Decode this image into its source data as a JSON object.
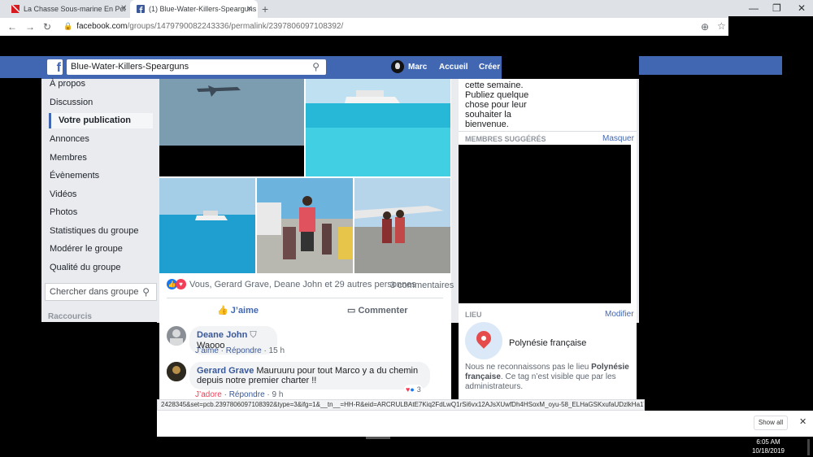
{
  "browser": {
    "tabs": [
      {
        "title": "La Chasse Sous-marine En Pol"
      },
      {
        "title": "(1) Blue-Water-Killers-Spearguns"
      }
    ],
    "url_host": "facebook.com",
    "url_path": "/groups/1479790082243336/permalink/2397806097108392/",
    "new_tab_glyph": "+",
    "status_url": "2428345&set=pcb.2397806097108392&type=3&ifg=1&__tn__=HH-R&eid=ARCRULBAtE7Kiq2FdLwQ1rSi6vx12AJsXUwfDh4HSoxM_oyu-58_ELHaGSKxufaUDzlkHa1V0AxftYfK"
  },
  "fb_header": {
    "group_search_value": "Blue-Water-Killers-Spearguns",
    "user_name": "Marc",
    "nav": [
      "Accueil",
      "Créer"
    ]
  },
  "left_nav": {
    "items": [
      "À propos",
      "Discussion",
      "Votre publication",
      "Annonces",
      "Membres",
      "Évènements",
      "Vidéos",
      "Photos",
      "Statistiques du groupe",
      "Modérer le groupe",
      "Qualité du groupe"
    ],
    "active_index": 2,
    "search_placeholder": "Chercher dans groupe",
    "shortcuts_heading": "Raccourcis"
  },
  "post": {
    "reactions_text": "Vous, Gerard Grave, Deane John et 29 autres personnes",
    "comments_count": "3 commentaires",
    "like_label": "J’aime",
    "comment_label": "Commenter",
    "comments": [
      {
        "author": "Deane John",
        "text": "Waooo",
        "actions": [
          "J’aime",
          "Répondre",
          "15 h"
        ]
      },
      {
        "author": "Gerard Grave",
        "text": "Mauruuru pour tout Marco y a du chemin depuis notre premier charter !!",
        "actions": [
          "J’adore",
          "Répondre",
          "9 h"
        ],
        "reaction_count": "3"
      }
    ]
  },
  "right_col": {
    "welcome_lines": [
      "cette semaine.",
      "Publiez quelque",
      "chose pour leur",
      "souhaiter la",
      "bienvenue."
    ],
    "suggested_heading": "MEMBRES SUGGÉRÉS",
    "suggested_hide": "Masquer",
    "location_heading": "LIEU",
    "location_edit": "Modifier",
    "location_name": "Polynésie française",
    "location_note_1": "Nous ne reconnaissons pas le lieu",
    "location_note_bold": "Polynésie française",
    "location_note_2": ". Ce tag n’est visible que par les administrateurs."
  },
  "downloads": {
    "show_all": "Show all"
  },
  "taskbar": {
    "time": "6:05 AM",
    "date": "10/18/2019"
  }
}
